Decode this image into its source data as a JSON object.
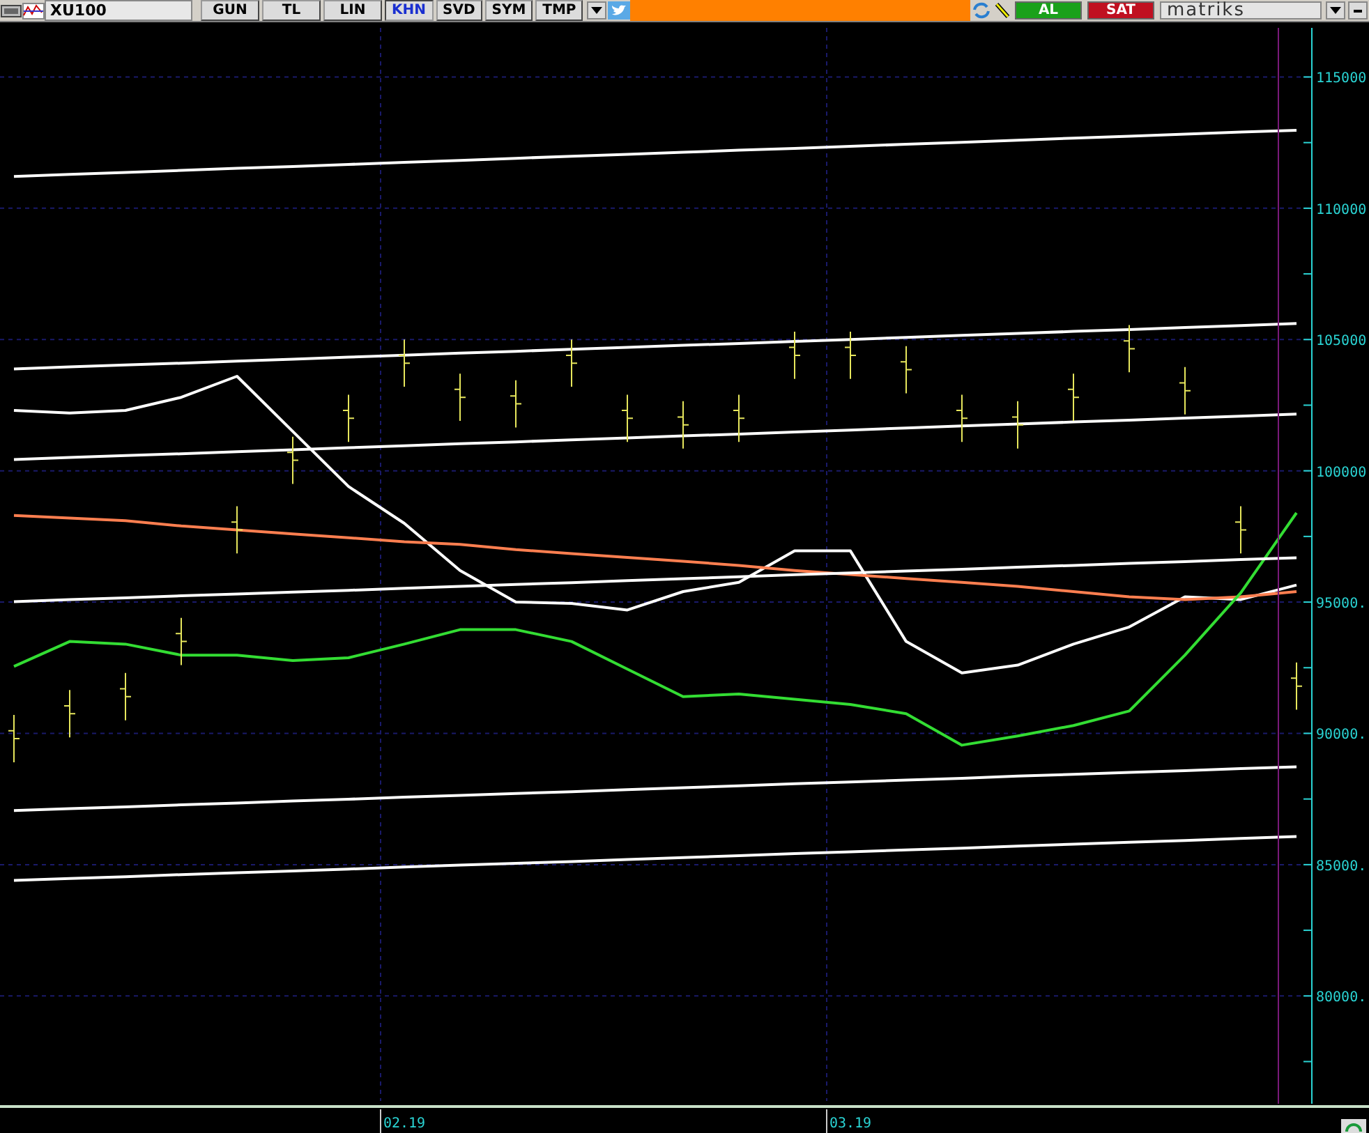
{
  "toolbar": {
    "symbol": "XU100",
    "buttons": [
      {
        "label": "GUN",
        "selected": false
      },
      {
        "label": "TL",
        "selected": false
      },
      {
        "label": "LIN",
        "selected": false
      },
      {
        "label": "KHN",
        "selected": true
      },
      {
        "label": "SVD",
        "selected": false
      },
      {
        "label": "SYM",
        "selected": false
      },
      {
        "label": "TMP",
        "selected": false
      }
    ],
    "buy": "AL",
    "sell": "SAT",
    "brand": "matriks"
  },
  "chart": {
    "chart_data": {
      "type": "line",
      "categories": [
        null,
        null,
        null,
        null,
        null,
        null,
        null,
        "02.19",
        null,
        null,
        null,
        null,
        null,
        null,
        null,
        "03.19",
        null,
        null,
        null,
        null,
        null,
        null,
        null,
        null
      ],
      "ylim": [
        76000,
        116870
      ],
      "grid": true,
      "yticks": [
        {
          "value": 115000,
          "label": "115000"
        },
        {
          "value": 110000,
          "label": "110000"
        },
        {
          "value": 105000,
          "label": "105000"
        },
        {
          "value": 100000,
          "label": "100000"
        },
        {
          "value": 95000,
          "label": "95000."
        },
        {
          "value": 90000,
          "label": "90000."
        },
        {
          "value": 85000,
          "label": "85000."
        },
        {
          "value": 80000,
          "label": "80000."
        }
      ],
      "series": [
        {
          "color": "#ffffff",
          "values": [
            102300,
            102200,
            102300,
            102800,
            103600,
            101500,
            99400,
            98000,
            96200,
            95000,
            94950,
            94700,
            95400,
            95750,
            96950,
            96950,
            93500,
            92300,
            92600,
            93400,
            94050,
            95200,
            95100,
            95650
          ]
        },
        {
          "color": "#ff7f50",
          "values": [
            98300,
            98200,
            98100,
            97900,
            97750,
            97600,
            97450,
            97300,
            97200,
            97000,
            96850,
            96700,
            96550,
            96400,
            96200,
            96050,
            95900,
            95750,
            95600,
            95400,
            95200,
            95100,
            95200,
            95400
          ]
        },
        {
          "color": "#33dd33",
          "values": [
            92550,
            93500,
            93400,
            92980,
            92980,
            92770,
            92880,
            93400,
            93950,
            93950,
            93500,
            92450,
            91400,
            91500,
            91300,
            91100,
            90750,
            89550,
            89900,
            90300,
            90850,
            92980,
            95350,
            98400
          ]
        },
        {
          "color": "#fffffe",
          "values": [
            111210,
            111290,
            111360,
            111440,
            111520,
            111590,
            111670,
            111750,
            111820,
            111900,
            111980,
            112050,
            112130,
            112210,
            112280,
            112360,
            112440,
            112510,
            112590,
            112670,
            112740,
            112820,
            112900,
            112970
          ]
        },
        {
          "color": "#fffffe",
          "values": [
            103880,
            103960,
            104030,
            104100,
            104180,
            104250,
            104330,
            104400,
            104480,
            104550,
            104630,
            104700,
            104780,
            104850,
            104930,
            105000,
            105080,
            105160,
            105230,
            105310,
            105380,
            105460,
            105530,
            105610
          ]
        },
        {
          "color": "#fffffe",
          "values": [
            100430,
            100510,
            100580,
            100650,
            100730,
            100800,
            100880,
            100950,
            101030,
            101100,
            101180,
            101250,
            101330,
            101400,
            101480,
            101550,
            101630,
            101710,
            101780,
            101860,
            101930,
            102010,
            102080,
            102160
          ]
        },
        {
          "color": "#fffffe",
          "values": [
            95020,
            95090,
            95160,
            95240,
            95310,
            95380,
            95450,
            95530,
            95600,
            95670,
            95740,
            95820,
            95890,
            95960,
            96040,
            96110,
            96180,
            96250,
            96330,
            96400,
            96470,
            96540,
            96620,
            96690
          ]
        },
        {
          "color": "#fffffe",
          "values": [
            87060,
            87130,
            87200,
            87280,
            87350,
            87420,
            87490,
            87570,
            87640,
            87710,
            87780,
            87860,
            87930,
            88000,
            88080,
            88150,
            88220,
            88290,
            88370,
            88440,
            88510,
            88580,
            88660,
            88730
          ]
        },
        {
          "color": "#fffffe",
          "values": [
            84400,
            84470,
            84540,
            84620,
            84690,
            84760,
            84830,
            84910,
            84980,
            85050,
            85120,
            85200,
            85270,
            85340,
            85420,
            85490,
            85560,
            85630,
            85710,
            85780,
            85850,
            85920,
            86000,
            86070
          ]
        }
      ]
    }
  }
}
